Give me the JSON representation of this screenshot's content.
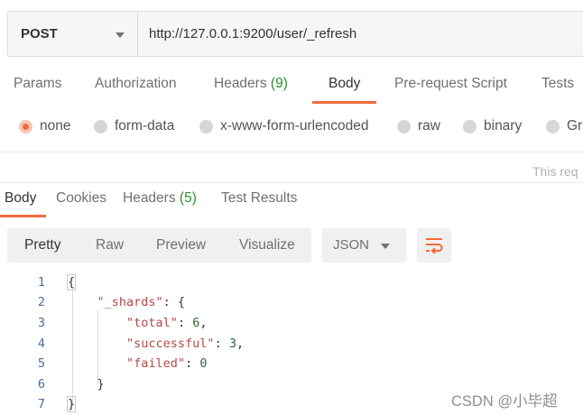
{
  "request": {
    "method": "POST",
    "url": "http://127.0.0.1:9200/user/_refresh"
  },
  "request_tabs": {
    "params": "Params",
    "authorization": "Authorization",
    "headers": "Headers",
    "headers_count": "(9)",
    "body": "Body",
    "prerequest": "Pre-request Script",
    "tests": "Tests"
  },
  "body_types": {
    "none": "none",
    "form_data": "form-data",
    "urlencoded": "x-www-form-urlencoded",
    "raw": "raw",
    "binary": "binary",
    "graphql": "Gra",
    "selected": "none"
  },
  "hint_text": "This req",
  "response_tabs": {
    "body": "Body",
    "cookies": "Cookies",
    "headers": "Headers",
    "headers_count": "(5)",
    "test_results": "Test Results"
  },
  "view_modes": {
    "pretty": "Pretty",
    "raw": "Raw",
    "preview": "Preview",
    "visualize": "Visualize",
    "selected": "Pretty"
  },
  "format": "JSON",
  "response_lines": [
    {
      "num": "1",
      "text": "{"
    },
    {
      "num": "2",
      "key": "\"_shards\"",
      "rest": ": {"
    },
    {
      "num": "3",
      "key": "\"total\"",
      "sep": ": ",
      "value": "6",
      "tail": ","
    },
    {
      "num": "4",
      "key": "\"successful\"",
      "sep": ": ",
      "value": "3",
      "tail": ","
    },
    {
      "num": "5",
      "key": "\"failed\"",
      "sep": ": ",
      "value": "0",
      "tail": ""
    },
    {
      "num": "6",
      "text": "}"
    },
    {
      "num": "7",
      "text": "}"
    }
  ],
  "watermark": "CSDN @小毕超",
  "colors": {
    "accent": "#f26b3a",
    "count_green": "#2c8f2c",
    "json_key": "#b24a4a",
    "json_number": "#2f6b3a"
  },
  "icons": {
    "method_dropdown": "chevron-down-icon",
    "format_dropdown": "chevron-down-icon",
    "wrap": "wrap-lines-icon"
  }
}
